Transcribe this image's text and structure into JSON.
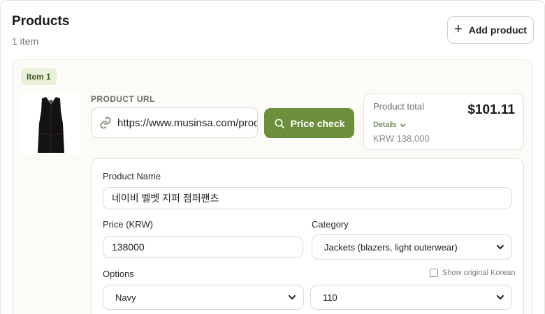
{
  "header": {
    "title": "Products",
    "count_label": "1 item",
    "add_button_label": "Add product"
  },
  "item": {
    "badge": "Item 1",
    "url_label": "PRODUCT URL",
    "url_value": "https://www.musinsa.com/products/",
    "price_check_label": "Price check",
    "total": {
      "label": "Product total",
      "value": "$101.11",
      "details_label": "Details",
      "krw": "KRW 138,000"
    },
    "form": {
      "name_label": "Product Name",
      "name_value": "네이비 벨벳 지퍼 점퍼팬츠",
      "price_label": "Price (KRW)",
      "price_value": "138000",
      "category_label": "Category",
      "category_value": "Jackets (blazers, light outerwear)",
      "options_label": "Options",
      "show_korean_label": "Show original Korean",
      "option_color": "Navy",
      "option_size": "110"
    }
  },
  "colors": {
    "accent": "#6b8f3c",
    "badge_bg": "#e8f0dc",
    "badge_text": "#3f5a22"
  },
  "icons": {
    "add": "plus-icon",
    "url": "link-icon",
    "price_check": "search-icon",
    "details": "chevron-down-icon",
    "product_image": "product-thumbnail"
  }
}
